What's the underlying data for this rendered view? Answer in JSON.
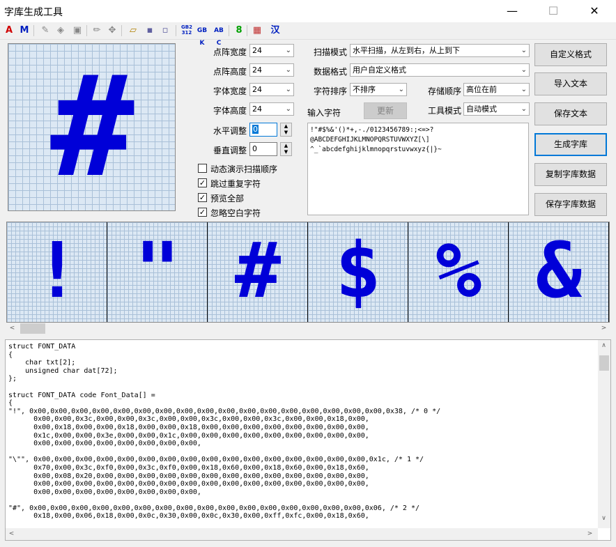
{
  "window": {
    "title": "字库生成工具",
    "minimize": "—",
    "maximize": "☐",
    "close": "✕"
  },
  "toolbar": {
    "items": [
      {
        "name": "font-a-icon",
        "label": "A",
        "color": "#d00000"
      },
      {
        "name": "font-m-icon",
        "label": "M",
        "color": "#0020c0"
      },
      {
        "name": "eraser-icon",
        "label": "✎",
        "color": "#888888"
      },
      {
        "name": "fill-icon",
        "label": "◈",
        "color": "#888888"
      },
      {
        "name": "stamp-icon",
        "label": "▣",
        "color": "#888888"
      },
      {
        "name": "pencil-icon",
        "label": "✏",
        "color": "#888888"
      },
      {
        "name": "move-icon",
        "label": "✥",
        "color": "#888888"
      },
      {
        "name": "open-folder-icon",
        "label": "▱",
        "color": "#b08000"
      },
      {
        "name": "save-icon",
        "label": "▪",
        "color": "#6060a0"
      },
      {
        "name": "save-as-icon",
        "label": "▫",
        "color": "#6060a0"
      },
      {
        "name": "gb2312-icon",
        "label": "GB2312",
        "color": "#0020c0"
      },
      {
        "name": "gbk-icon",
        "label": "GBK",
        "color": "#0020c0"
      },
      {
        "name": "abc-icon",
        "label": "ABC",
        "color": "#0020c0"
      },
      {
        "name": "digit-8-icon",
        "label": "8",
        "color": "#00a000"
      },
      {
        "name": "palette-icon",
        "label": "▦",
        "color": "#c03030"
      },
      {
        "name": "chinese-icon",
        "label": "汉",
        "color": "#0020c0"
      }
    ]
  },
  "accent": "#0000d8",
  "preview": {
    "glyph": "#"
  },
  "settings": {
    "dot_width_label": "点阵宽度",
    "dot_width": "24",
    "dot_height_label": "点阵高度",
    "dot_height": "24",
    "font_width_label": "字体宽度",
    "font_width": "24",
    "font_height_label": "字体高度",
    "font_height": "24",
    "h_adjust_label": "水平调整",
    "h_adjust": "0",
    "v_adjust_label": "垂直调整",
    "v_adjust": "0",
    "scan_mode_label": "扫描模式",
    "scan_mode": "水平扫描，从左到右，从上到下",
    "data_format_label": "数据格式",
    "data_format": "用户自定义格式",
    "char_sort_label": "字符排序",
    "char_sort": "不排序",
    "store_order_label": "存储顺序",
    "store_order": "高位在前",
    "input_chars_label": "输入字符",
    "update_button": "更新",
    "tool_mode_label": "工具模式",
    "tool_mode": "自动模式"
  },
  "checkboxes": [
    {
      "label": "动态演示扫描顺序",
      "checked": false
    },
    {
      "label": "跳过重复字符",
      "checked": true
    },
    {
      "label": "预览全部",
      "checked": true
    },
    {
      "label": "忽略空白字符",
      "checked": true
    }
  ],
  "input_text": "!\"#$%&'()*+,-./0123456789:;<=>?\n@ABCDEFGHIJKLMNOPQRSTUVWXYZ[\\]\n^_`abcdefghijklmnopqrstuvwxyz{|}~",
  "buttons": {
    "custom_format": "自定义格式",
    "import_text": "导入文本",
    "save_text": "保存文本",
    "generate": "生成字库",
    "copy_data": "复制字库数据",
    "save_data": "保存字库数据"
  },
  "strip": {
    "glyphs": [
      "!",
      "\"",
      "#",
      "$",
      "%",
      "&"
    ]
  },
  "code_lines": [
    "struct FONT_DATA",
    "{",
    "    char txt[2];",
    "    unsigned char dat[72];",
    "};",
    "",
    "struct FONT_DATA code Font_Data[] =",
    "{",
    "\"!\", 0x00,0x00,0x00,0x00,0x00,0x00,0x00,0x00,0x00,0x00,0x00,0x00,0x00,0x00,0x00,0x00,0x00,0x38, /* 0 */",
    "      0x00,0x00,0x3c,0x00,0x00,0x3c,0x00,0x00,0x3c,0x00,0x00,0x3c,0x00,0x00,0x18,0x00,",
    "      0x00,0x18,0x00,0x00,0x18,0x00,0x00,0x18,0x00,0x00,0x00,0x00,0x00,0x00,0x00,0x00,",
    "      0x1c,0x00,0x00,0x3e,0x00,0x00,0x1c,0x00,0x00,0x00,0x00,0x00,0x00,0x00,0x00,0x00,",
    "      0x00,0x00,0x00,0x00,0x00,0x00,0x00,0x00,",
    "",
    "\"\\\"\", 0x00,0x00,0x00,0x00,0x00,0x00,0x00,0x00,0x00,0x00,0x00,0x00,0x00,0x00,0x00,0x00,0x1c, /* 1 */",
    "      0x70,0x00,0x3c,0xf0,0x00,0x3c,0xf0,0x00,0x18,0x60,0x00,0x18,0x60,0x00,0x18,0x60,",
    "      0x00,0x08,0x20,0x00,0x00,0x00,0x00,0x00,0x00,0x00,0x00,0x00,0x00,0x00,0x00,0x00,",
    "      0x00,0x00,0x00,0x00,0x00,0x00,0x00,0x00,0x00,0x00,0x00,0x00,0x00,0x00,0x00,0x00,",
    "      0x00,0x00,0x00,0x00,0x00,0x00,0x00,0x00,",
    "",
    "\"#\", 0x00,0x00,0x00,0x00,0x00,0x00,0x00,0x00,0x00,0x00,0x00,0x00,0x00,0x00,0x00,0x00,0x06, /* 2 */",
    "      0x18,0x00,0x06,0x18,0x00,0x0c,0x30,0x00,0x0c,0x30,0x00,0xff,0xfc,0x00,0x18,0x60,"
  ]
}
